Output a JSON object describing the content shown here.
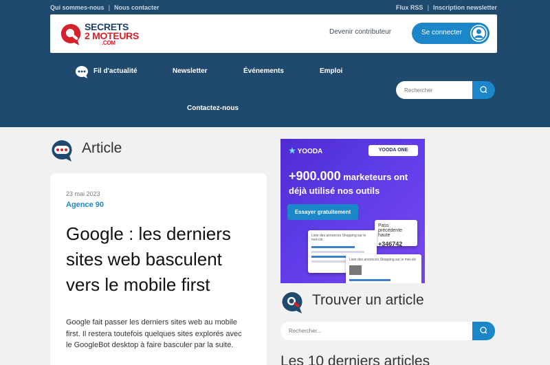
{
  "topbar": {
    "links_left": [
      "Qui sommes-nous",
      "Nous contacter"
    ],
    "links_right": [
      "Flux RSS",
      "Inscription newsletter"
    ],
    "separator": "|"
  },
  "header": {
    "logo_line1": "SECRETS",
    "logo_line2": "2 MOTEURS",
    "logo_line3": ".COM",
    "contributor_link": "Devenir contributeur",
    "login_button": "Se connecter"
  },
  "nav": {
    "items": [
      "Fil d'actualité",
      "Newsletter",
      "Événements",
      "Emploi",
      "Contactez-nous"
    ],
    "search_placeholder": "Rechercher"
  },
  "article_section": {
    "heading": "Article",
    "date": "23 mai 2023",
    "author": "Agence 90",
    "title": "Google : les derniers sites web basculent vers le mobile first",
    "excerpt": "Google fait passer les derniers sites web au mobile first. Il restera toutefois quelques sites explorés avec le GoogleBot desktop à faire basculer par la suite."
  },
  "ad": {
    "brand": "YOODA",
    "brand_one": "YOODA ONE",
    "headline_number": "+900.000",
    "headline_rest": "marketeurs ont déjà utilisé nos outils",
    "cta": "Essayer gratuitement",
    "stat_label": "Pass précédente haute",
    "stat_value": "+346742",
    "panel1_label": "Liste des annonces Shopping sur le mot-clé",
    "panel2_label": "Liste des annonces Shopping sur le mot-clé"
  },
  "sidebar": {
    "find_heading": "Trouver un article",
    "search_placeholder": "Rechercher...",
    "latest_heading": "Les 10 derniers articles"
  },
  "colors": {
    "navy": "#1f4a6e",
    "accent": "#1b86c8",
    "logo_red": "#d6202b",
    "logo_blue": "#1f3d6b"
  }
}
